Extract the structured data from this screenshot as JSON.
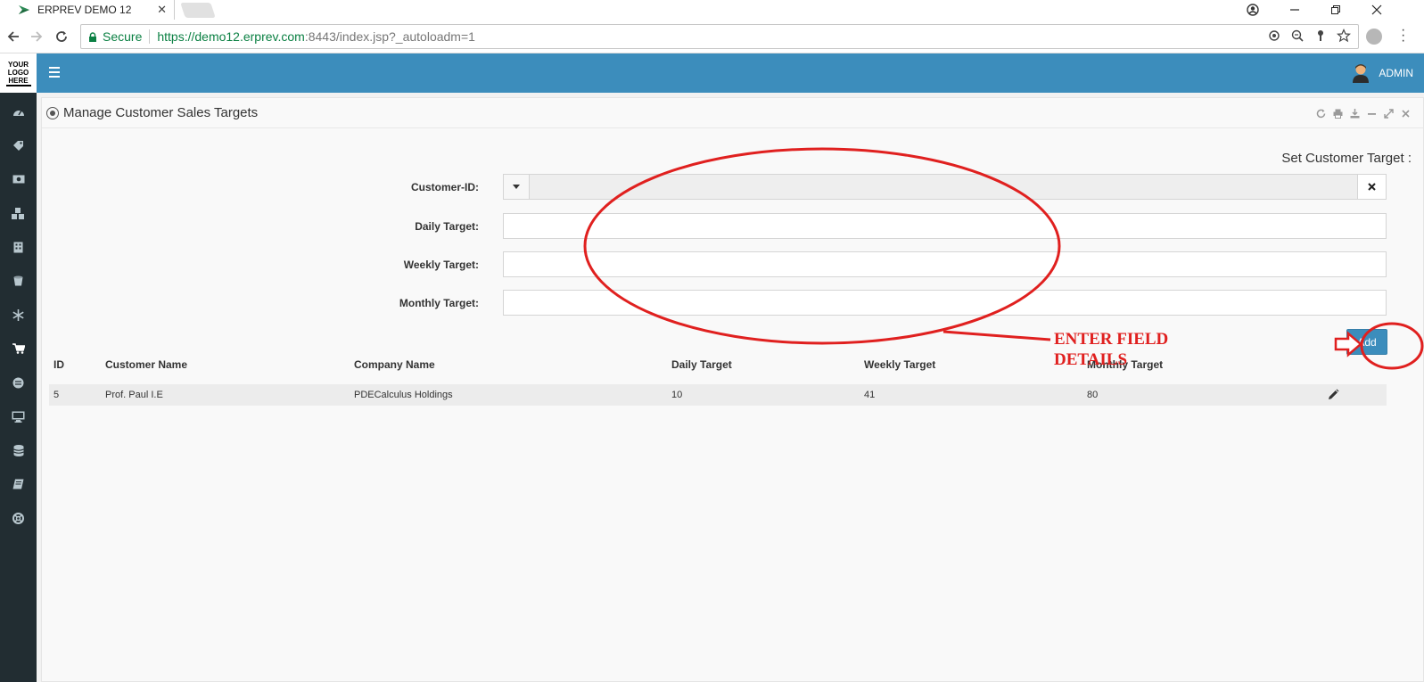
{
  "browser": {
    "tab_title": "ERPREV DEMO 12",
    "tab_close": "✕",
    "secure_label": "Secure",
    "url_scheme_host": "https://demo12.erprev.com",
    "url_rest": ":8443/index.jsp?_autoloadm=1",
    "window_controls": [
      "minimize-icon",
      "restore-icon",
      "close-icon"
    ]
  },
  "app": {
    "logo_text": "YOUR LOGO HERE",
    "user_name": "ADMIN",
    "accent_color": "#3c8dbc",
    "sidebar_color": "#222d32",
    "sidebar_icons": [
      "dashboard-icon",
      "tag-icon",
      "money-icon",
      "cubes-icon",
      "building-icon",
      "bucket-icon",
      "snowflake-icon",
      "cart-icon",
      "circle-icon",
      "desktop-icon",
      "database-icon",
      "book-icon",
      "lifebuoy-icon"
    ],
    "sidebar_active_index": 7
  },
  "panel": {
    "title": "Manage Customer Sales Targets",
    "tools": [
      "refresh-icon",
      "print-icon",
      "download-icon",
      "minimize-icon",
      "expand-icon",
      "close-icon"
    ],
    "section_title": "Set Customer Target :"
  },
  "form": {
    "customer_id_label": "Customer-ID:",
    "customer_id_value": "",
    "daily_label": "Daily Target:",
    "daily_value": "",
    "weekly_label": "Weekly Target:",
    "weekly_value": "",
    "monthly_label": "Monthly Target:",
    "monthly_value": "",
    "add_button": "Add"
  },
  "table": {
    "columns": [
      "ID",
      "Customer Name",
      "Company Name",
      "Daily Target",
      "Weekly Target",
      "Monthly Target"
    ],
    "rows": [
      {
        "id": "5",
        "customer": "Prof. Paul I.E",
        "company": "PDECalculus Holdings",
        "daily": "10",
        "weekly": "41",
        "monthly": "80"
      }
    ]
  },
  "annotation": {
    "text_line1": "ENTER FIELD",
    "text_line2": "DETAILS",
    "color": "#e0201f"
  }
}
